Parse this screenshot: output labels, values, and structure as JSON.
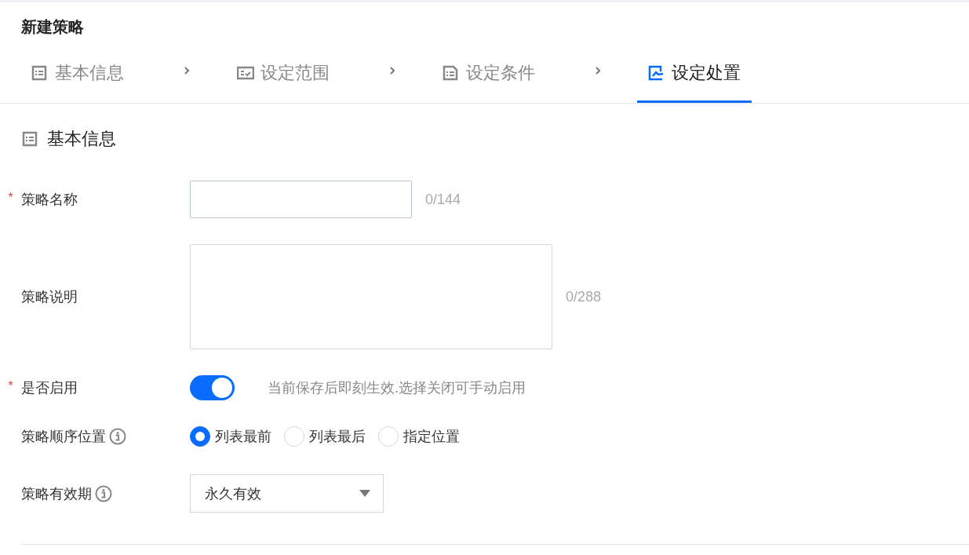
{
  "title": "新建策略",
  "steps": [
    {
      "label": "基本信息",
      "kind": "list",
      "selected": false
    },
    {
      "label": "设定范围",
      "kind": "check",
      "selected": false
    },
    {
      "label": "设定条件",
      "kind": "doc",
      "selected": false
    },
    {
      "label": "设定处置",
      "kind": "edit",
      "selected": true
    }
  ],
  "section": {
    "title": "基本信息"
  },
  "fields": [
    {
      "kind": "input",
      "label": "策略名称",
      "required_mark": "*",
      "counter": "0/144"
    },
    {
      "kind": "textarea",
      "label": "策略说明",
      "counter": "0/288"
    },
    {
      "kind": "switch",
      "label": "是否启用",
      "required_mark": "*",
      "on": true,
      "hint": "当前保存后即刻生效.选择关闭可手动启用"
    },
    {
      "kind": "radio",
      "label": "策略顺序位置",
      "info": true,
      "options": [
        {
          "label": "列表最前",
          "selected": true
        },
        {
          "label": "列表最后",
          "selected": false
        },
        {
          "label": "指定位置",
          "selected": false
        }
      ]
    },
    {
      "kind": "select",
      "label": "策略有效期",
      "info": true,
      "value": "永久有效"
    }
  ]
}
